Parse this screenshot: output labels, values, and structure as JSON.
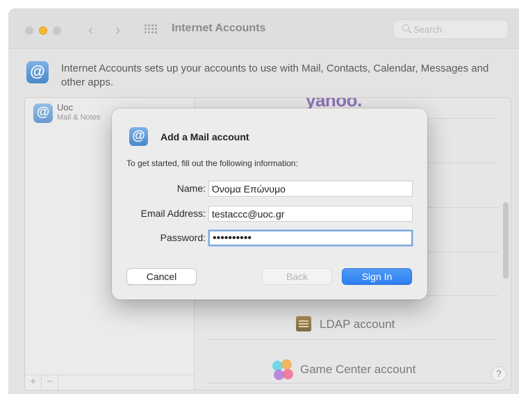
{
  "window": {
    "title": "Internet Accounts",
    "search_placeholder": "Search",
    "header_text": "Internet Accounts sets up your accounts to use with Mail, Contacts, Calendar, Messages and other apps."
  },
  "sidebar": {
    "accounts": [
      {
        "name": "Uoc",
        "subtitle": "Mail & Notes"
      }
    ],
    "add_label": "+",
    "remove_label": "−"
  },
  "providers": {
    "logo_text": "yahoo.",
    "items": [
      {
        "label": "LDAP account",
        "icon": "ldap-icon"
      },
      {
        "label": "Game Center account",
        "icon": "game-center-icon"
      }
    ],
    "help_label": "?"
  },
  "dialog": {
    "title": "Add a Mail account",
    "instructions": "To get started, fill out the following information:",
    "fields": {
      "name": {
        "label": "Name:",
        "value": "Όνομα Επώνυμο"
      },
      "email": {
        "label": "Email Address:",
        "value": "testaccc@uoc.gr"
      },
      "password": {
        "label": "Password:",
        "value": "password12"
      }
    },
    "buttons": {
      "cancel": "Cancel",
      "back": "Back",
      "sign_in": "Sign In"
    }
  },
  "colors": {
    "accent": "#2f7ef0",
    "yahoo": "#8d73b7",
    "minimize": "#f5b82e"
  }
}
